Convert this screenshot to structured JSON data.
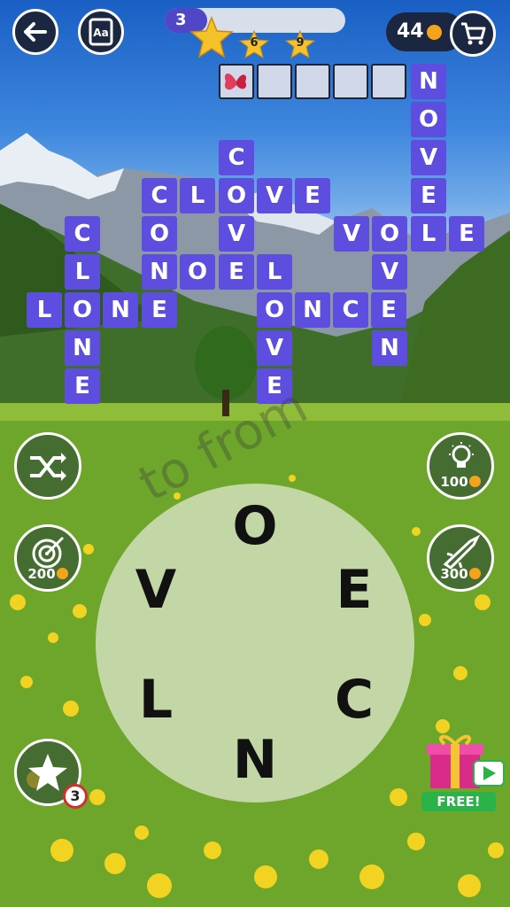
{
  "header": {
    "level": "3",
    "star_milestones": [
      "6",
      "9"
    ],
    "coins": "44"
  },
  "hints": {
    "shuffle_label": "",
    "bulb_cost": "100",
    "target_cost": "200",
    "rocket_cost": "300",
    "star_count": "3"
  },
  "wheel": {
    "letters": [
      "O",
      "E",
      "C",
      "N",
      "L",
      "V"
    ]
  },
  "promo": {
    "free_label": "FREE!"
  },
  "watermark": "to from"
}
